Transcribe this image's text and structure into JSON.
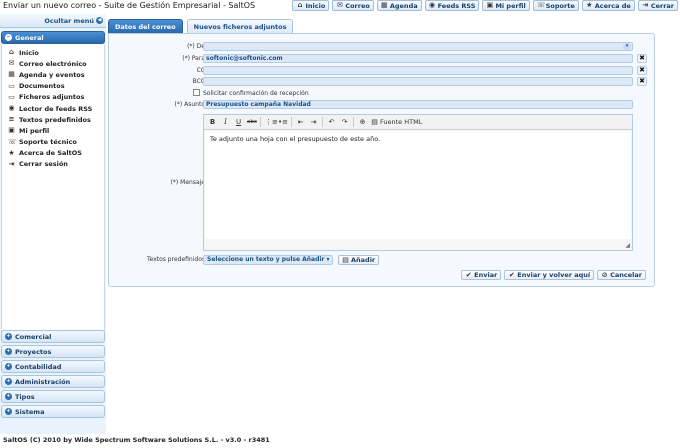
{
  "window": {
    "title": "Enviar un nuevo correo - Suite de Gestión Empresarial - SaltOS"
  },
  "topnav": [
    {
      "label": "Inicio",
      "icon": "home-icon"
    },
    {
      "label": "Correo",
      "icon": "mail-icon"
    },
    {
      "label": "Agenda",
      "icon": "calendar-icon"
    },
    {
      "label": "Feeds RSS",
      "icon": "rss-icon"
    },
    {
      "label": "Mi perfil",
      "icon": "profile-icon"
    },
    {
      "label": "Soporte",
      "icon": "support-icon"
    },
    {
      "label": "Acerca de",
      "icon": "star-icon"
    },
    {
      "label": "Cerrar",
      "icon": "logout-icon"
    }
  ],
  "sidebar": {
    "hide_label": "Ocultar menú",
    "active_group": "General",
    "items": [
      {
        "label": "Inicio",
        "icon": "home-icon"
      },
      {
        "label": "Correo electrónico",
        "icon": "mail-icon"
      },
      {
        "label": "Agenda y eventos",
        "icon": "calendar-icon"
      },
      {
        "label": "Documentos",
        "icon": "folder-icon"
      },
      {
        "label": "Ficheros adjuntos",
        "icon": "folder-icon"
      },
      {
        "label": "Lector de feeds RSS",
        "icon": "rss-icon"
      },
      {
        "label": "Textos predefinidos",
        "icon": "text-icon"
      },
      {
        "label": "Mi perfil",
        "icon": "profile-icon"
      },
      {
        "label": "Soporte técnico",
        "icon": "support-icon"
      },
      {
        "label": "Acerca de SaltOS",
        "icon": "star-icon"
      },
      {
        "label": "Cerrar sesión",
        "icon": "logout-icon"
      }
    ],
    "groups": [
      "Comercial",
      "Proyectos",
      "Contabilidad",
      "Administración",
      "Tipos",
      "Sistema"
    ]
  },
  "tabs": [
    "Datos del correo",
    "Nuevos ficheros adjuntos"
  ],
  "form": {
    "de_label": "(*) De",
    "de_value": "",
    "para_label": "(*) Para",
    "para_value": "softonic@softonic.com",
    "cc_label": "CC",
    "bcc_label": "BCC",
    "confirm_label": "Solicitar confirmación de recepción",
    "asunto_label": "(*) Asunto",
    "asunto_value": "Presupuesto campaña Navidad",
    "mensaje_label": "(*) Mensaje",
    "mensaje_value": "Te adjunto una hoja con el presupuesto de este año.",
    "fuente_html": "Fuente HTML",
    "textos_label": "Textos predefinidos",
    "textos_select": "Seleccione un texto y pulse Añadir",
    "anadir": "Añadir"
  },
  "actions": {
    "enviar": "Enviar",
    "enviar_volver": "Enviar y volver aquí",
    "cancelar": "Cancelar"
  },
  "footer": "SaltOS (C) 2010 by Wide Spectrum Software Solutions S.L. - v3.0 - r3481"
}
